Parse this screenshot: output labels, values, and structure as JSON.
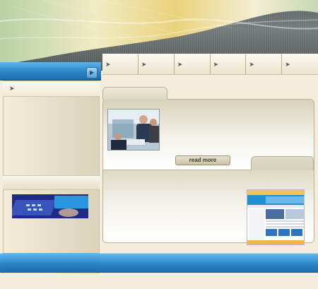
{
  "header": {
    "colors": {
      "wave_cream": "#efe6b2",
      "wave_gold": "#e8cf6a",
      "wave_green": "#b9d49a",
      "stripe_gray": "#6a6f71"
    }
  },
  "nav": {
    "items": [
      {
        "icon": "chevron-right-icon"
      },
      {
        "icon": "chevron-right-icon"
      },
      {
        "icon": "chevron-right-icon"
      },
      {
        "icon": "chevron-right-icon"
      },
      {
        "icon": "chevron-right-icon"
      },
      {
        "icon": "chevron-right-icon"
      }
    ]
  },
  "sidebar": {
    "head_icon": "chevron-right-icon"
  },
  "content": {
    "read_more_label": "read more"
  },
  "colors": {
    "accent_blue": "#2a85c6",
    "cream": "#f4ecdc",
    "panel_border": "#b9b192"
  }
}
